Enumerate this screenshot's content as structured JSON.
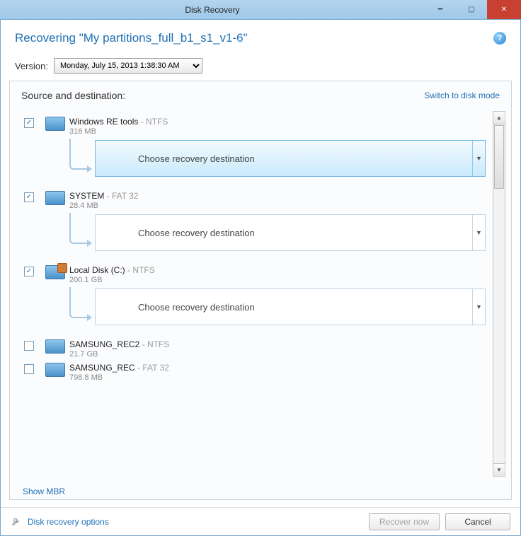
{
  "window": {
    "title": "Disk Recovery"
  },
  "header": {
    "title": "Recovering \"My partitions_full_b1_s1_v1-6\""
  },
  "version": {
    "label": "Version:",
    "selected": "Monday, July 15, 2013 1:38:30 AM"
  },
  "panel": {
    "title": "Source and destination:",
    "switch": "Switch to disk mode"
  },
  "dest_placeholder": "Choose recovery destination",
  "items": [
    {
      "checked": true,
      "name": "Windows RE tools",
      "fs": "NTFS",
      "size": "316 MB",
      "dest": true,
      "hl": true,
      "sys": false
    },
    {
      "checked": true,
      "name": "SYSTEM",
      "fs": "FAT 32",
      "size": "28.4 MB",
      "dest": true,
      "hl": false,
      "sys": false
    },
    {
      "checked": true,
      "name": "Local Disk (C:)",
      "fs": "NTFS",
      "size": "200.1 GB",
      "dest": true,
      "hl": false,
      "sys": true
    },
    {
      "checked": false,
      "name": "SAMSUNG_REC2",
      "fs": "NTFS",
      "size": "21.7 GB",
      "dest": false,
      "hl": false,
      "sys": false
    },
    {
      "checked": false,
      "name": "SAMSUNG_REC",
      "fs": "FAT 32",
      "size": "798.8 MB",
      "dest": false,
      "hl": false,
      "sys": false
    }
  ],
  "show_mbr": "Show MBR",
  "footer": {
    "options": "Disk recovery options",
    "recover": "Recover now",
    "cancel": "Cancel"
  }
}
